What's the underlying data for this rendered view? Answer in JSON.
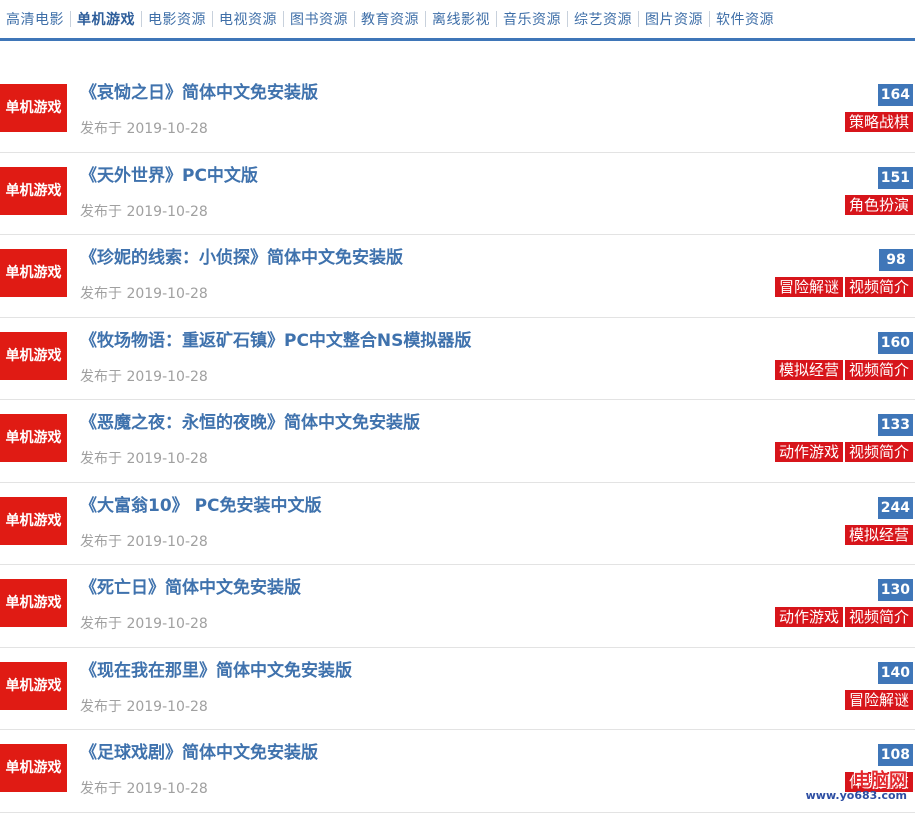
{
  "nav": {
    "items": [
      {
        "label": "高清电影"
      },
      {
        "label": "单机游戏",
        "active": true
      },
      {
        "label": "电影资源"
      },
      {
        "label": "电视资源"
      },
      {
        "label": "图书资源"
      },
      {
        "label": "教育资源"
      },
      {
        "label": "离线影视"
      },
      {
        "label": "音乐资源"
      },
      {
        "label": "综艺资源"
      },
      {
        "label": "图片资源"
      },
      {
        "label": "软件资源"
      }
    ]
  },
  "list": {
    "items": [
      {
        "badge": "单机游戏",
        "title": "《哀恸之日》简体中文免安装版",
        "date": "发布于 2019-10-28",
        "count": "164",
        "tags": [
          "策略战棋"
        ]
      },
      {
        "badge": "单机游戏",
        "title": "《天外世界》PC中文版",
        "date": "发布于 2019-10-28",
        "count": "151",
        "tags": [
          "角色扮演"
        ]
      },
      {
        "badge": "单机游戏",
        "title": "《珍妮的线索：小侦探》简体中文免安装版",
        "date": "发布于 2019-10-28",
        "count": "98",
        "tags": [
          "冒险解谜",
          "视频简介"
        ]
      },
      {
        "badge": "单机游戏",
        "title": "《牧场物语：重返矿石镇》PC中文整合NS模拟器版",
        "date": "发布于 2019-10-28",
        "count": "160",
        "tags": [
          "模拟经营",
          "视频简介"
        ]
      },
      {
        "badge": "单机游戏",
        "title": "《恶魔之夜：永恒的夜晚》简体中文免安装版",
        "date": "发布于 2019-10-28",
        "count": "133",
        "tags": [
          "动作游戏",
          "视频简介"
        ]
      },
      {
        "badge": "单机游戏",
        "title": "《大富翁10》 PC免安装中文版",
        "date": "发布于 2019-10-28",
        "count": "244",
        "tags": [
          "模拟经营"
        ]
      },
      {
        "badge": "单机游戏",
        "title": "《死亡日》简体中文免安装版",
        "date": "发布于 2019-10-28",
        "count": "130",
        "tags": [
          "动作游戏",
          "视频简介"
        ]
      },
      {
        "badge": "单机游戏",
        "title": "《现在我在那里》简体中文免安装版",
        "date": "发布于 2019-10-28",
        "count": "140",
        "tags": [
          "冒险解谜"
        ]
      },
      {
        "badge": "单机游戏",
        "title": "《足球戏剧》简体中文免安装版",
        "date": "发布于 2019-10-28",
        "count": "108",
        "tags": [
          "体育竞技"
        ]
      }
    ]
  },
  "watermark": {
    "text": "电脑网",
    "url": "www.yo683.com"
  },
  "colors": {
    "accent_blue": "#3f76b8",
    "badge_red": "#e01b14",
    "tag_red": "#d7151b",
    "title_blue": "#3f72ad",
    "date_gray": "#a0a0a0"
  }
}
